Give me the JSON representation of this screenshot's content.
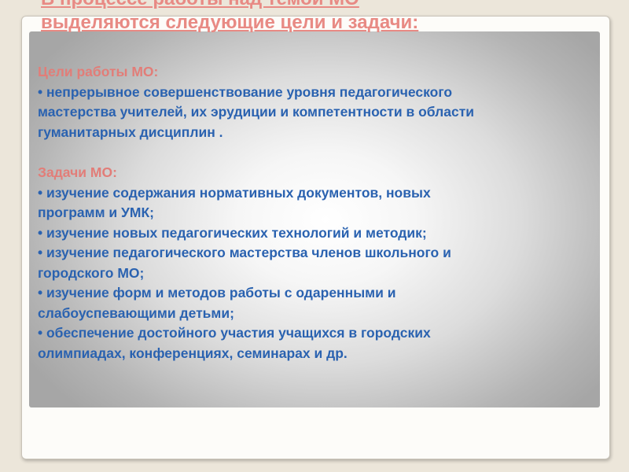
{
  "slide": {
    "title_line1": "В процессе работы над темой МО",
    "title_line2": "выделяются следующие цели и задачи:"
  },
  "goals": {
    "heading": "Цели работы МО:",
    "lines": [
      " •  непрерывное совершенствование уровня педагогического",
      "мастерства учителей, их эрудиции и компетентности в области",
      "гуманитарных дисциплин ."
    ]
  },
  "tasks": {
    "heading": "Задачи МО:",
    "lines": [
      " • изучение содержания нормативных документов, новых",
      "программ и УМК;",
      " •  изучение новых педагогических технологий и методик;",
      " •  изучение педагогического мастерства членов школьного и",
      "городского МО;",
      " •  изучение форм и методов работы с одаренными и",
      "слабоуспевающими детьми;",
      " •   обеспечение достойного участия учащихся в городских",
      "олимпиадах, конференциях, семинарах и др."
    ]
  }
}
